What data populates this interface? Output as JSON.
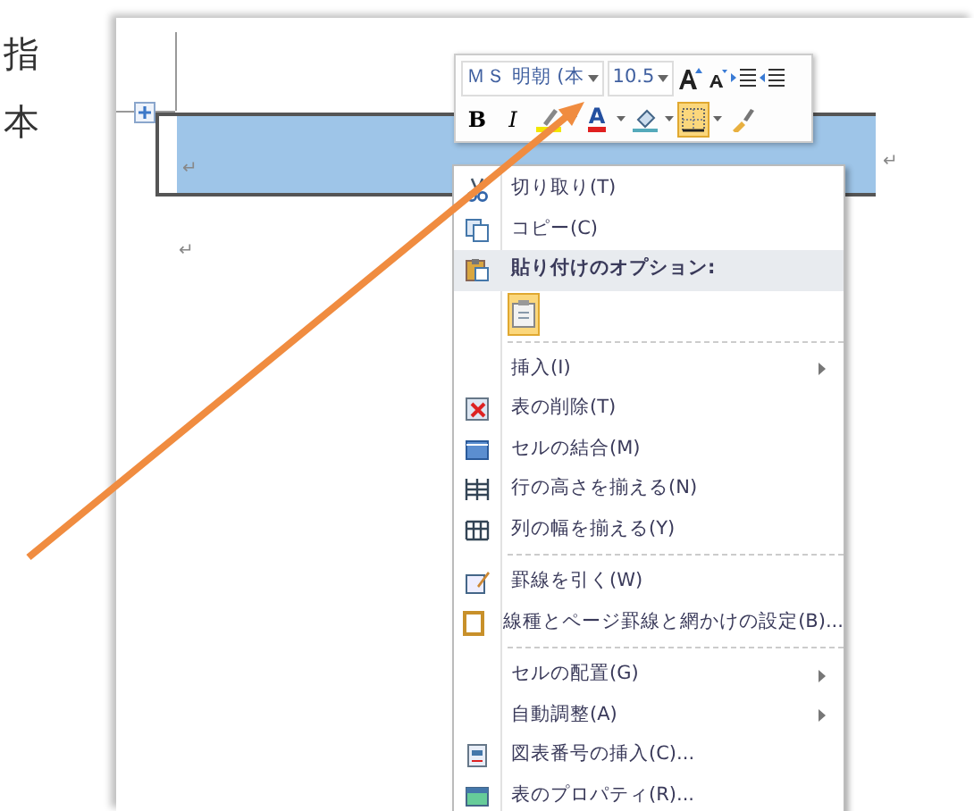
{
  "side_text": [
    "指",
    "本"
  ],
  "document": {
    "table": {
      "rows": [
        {
          "selected": true,
          "cell_mark": "↵",
          "row_mark": "↵"
        }
      ]
    },
    "paragraph_mark": "↵"
  },
  "mini_toolbar": {
    "font_name": "ＭＳ 明朝 (本",
    "font_size": "10.5",
    "format_buttons": [
      {
        "kind": "bold",
        "label": "B",
        "pressed": false
      },
      {
        "kind": "italic",
        "label": "I",
        "pressed": false
      },
      {
        "kind": "highlight",
        "pressed": false
      },
      {
        "kind": "font-color",
        "label": "A",
        "pressed": false
      },
      {
        "kind": "shading",
        "pressed": false
      },
      {
        "kind": "borders",
        "pressed": true
      },
      {
        "kind": "format-painter",
        "pressed": false
      }
    ]
  },
  "context_menu": {
    "items": [
      {
        "kind": "item",
        "label": "切り取り(T)",
        "submenu": false
      },
      {
        "kind": "item",
        "label": "コピー(C)",
        "submenu": false
      },
      {
        "kind": "header",
        "label": "貼り付けのオプション:"
      },
      {
        "kind": "paste-option"
      },
      {
        "kind": "separator"
      },
      {
        "kind": "item",
        "label": "挿入(I)",
        "submenu": true
      },
      {
        "kind": "item",
        "label": "表の削除(T)",
        "submenu": false
      },
      {
        "kind": "item",
        "label": "セルの結合(M)",
        "submenu": false
      },
      {
        "kind": "item",
        "label": "行の高さを揃える(N)",
        "submenu": false
      },
      {
        "kind": "item",
        "label": "列の幅を揃える(Y)",
        "submenu": false
      },
      {
        "kind": "separator"
      },
      {
        "kind": "item",
        "label": "罫線を引く(W)",
        "submenu": false
      },
      {
        "kind": "item",
        "label": "線種とページ罫線と網かけの設定(B)...",
        "submenu": false
      },
      {
        "kind": "separator"
      },
      {
        "kind": "item",
        "label": "セルの配置(G)",
        "submenu": true
      },
      {
        "kind": "item",
        "label": "自動調整(A)",
        "submenu": true
      },
      {
        "kind": "item",
        "label": "図表番号の挿入(C)...",
        "submenu": false
      },
      {
        "kind": "item",
        "label": "表のプロパティ(R)...",
        "submenu": false
      }
    ]
  }
}
